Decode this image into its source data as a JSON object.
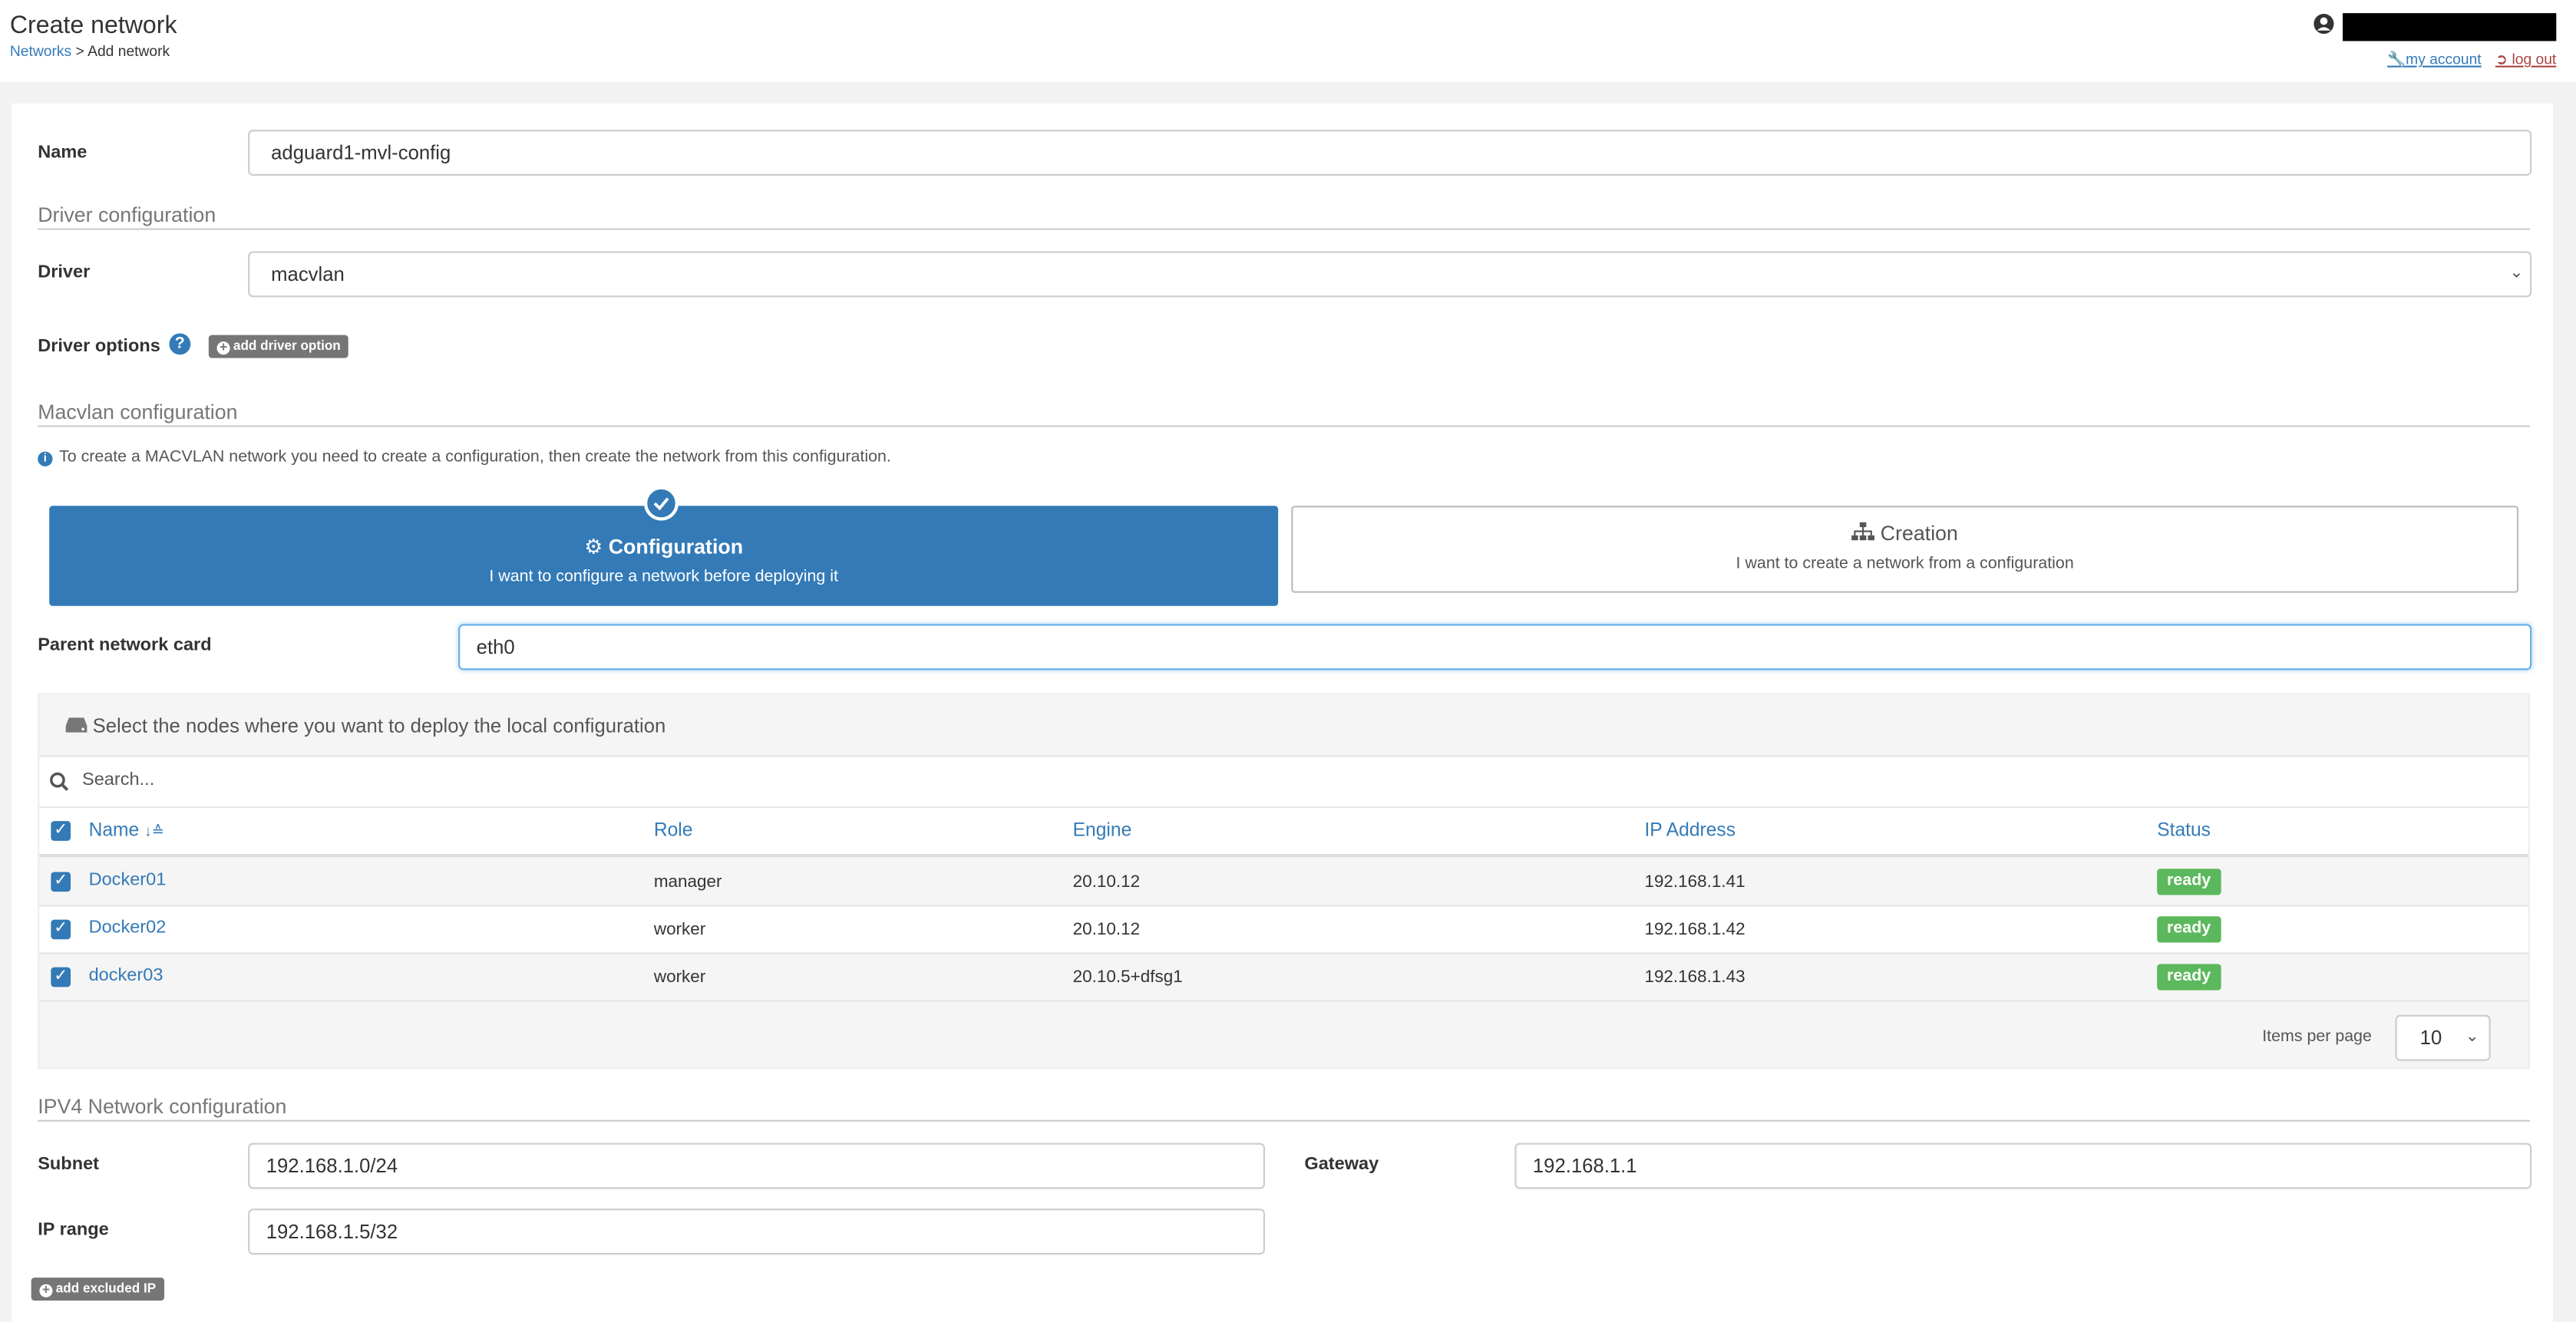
{
  "header": {
    "title": "Create network",
    "breadcrumb_link": "Networks",
    "breadcrumb_sep": ">",
    "breadcrumb_current": "Add network",
    "my_account": "my account",
    "log_out": "log out"
  },
  "form": {
    "name_label": "Name",
    "name_value": "adguard1-mvl-config",
    "driver_section": "Driver configuration",
    "driver_label": "Driver",
    "driver_value": "macvlan",
    "driver_options_label": "Driver options",
    "add_driver_option": "add driver option",
    "macvlan_section": "Macvlan configuration",
    "macvlan_info": "To create a MACVLAN network you need to create a configuration, then create the network from this configuration.",
    "mode_config_title": "Configuration",
    "mode_config_desc": "I want to configure a network before deploying it",
    "mode_creation_title": "Creation",
    "mode_creation_desc": "I want to create a network from a configuration",
    "parent_card_label": "Parent network card",
    "parent_card_value": "eth0"
  },
  "nodes": {
    "header": "Select the nodes where you want to deploy the local configuration",
    "search_placeholder": "Search...",
    "columns": {
      "name": "Name",
      "role": "Role",
      "engine": "Engine",
      "ip": "IP Address",
      "status": "Status"
    },
    "rows": [
      {
        "name": "Docker01",
        "role": "manager",
        "engine": "20.10.12",
        "ip": "192.168.1.41",
        "status": "ready"
      },
      {
        "name": "Docker02",
        "role": "worker",
        "engine": "20.10.12",
        "ip": "192.168.1.42",
        "status": "ready"
      },
      {
        "name": "docker03",
        "role": "worker",
        "engine": "20.10.5+dfsg1",
        "ip": "192.168.1.43",
        "status": "ready"
      }
    ],
    "items_per_page_label": "Items per page",
    "items_per_page_value": "10"
  },
  "ipv4": {
    "section": "IPV4 Network configuration",
    "subnet_label": "Subnet",
    "subnet_value": "192.168.1.0/24",
    "gateway_label": "Gateway",
    "gateway_value": "192.168.1.1",
    "ip_range_label": "IP range",
    "ip_range_value": "192.168.1.5/32",
    "add_excluded_ip": "add excluded IP"
  },
  "colors": {
    "primary": "#337ab7",
    "success": "#5cb85c",
    "danger": "#a94442",
    "muted_button": "#767676"
  }
}
